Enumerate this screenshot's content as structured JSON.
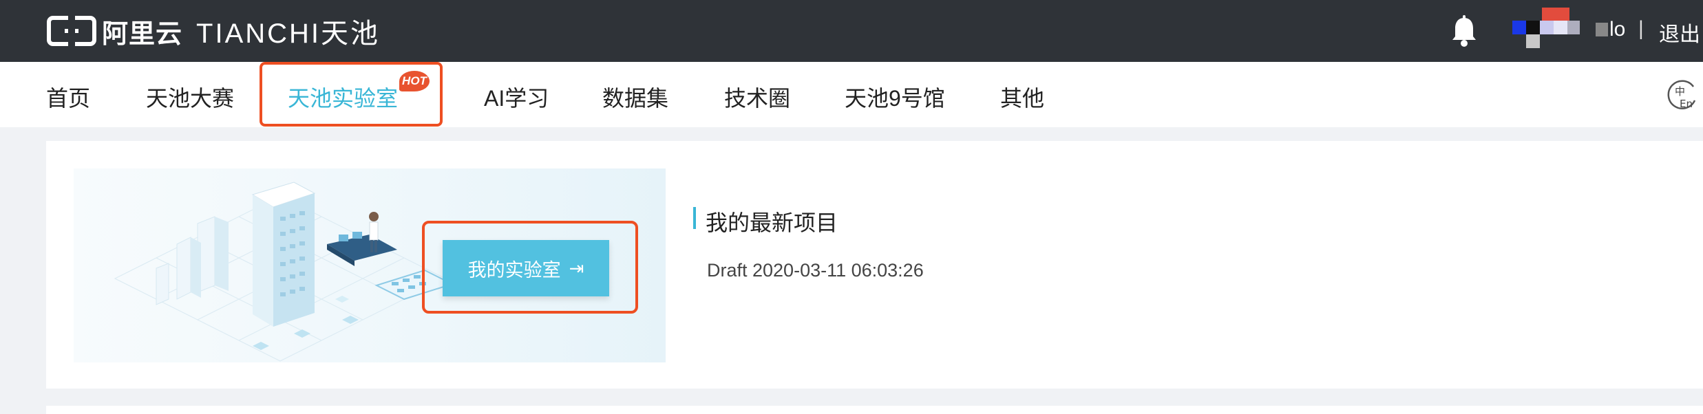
{
  "header": {
    "brand_cn": "阿里云",
    "brand_en": "TIANCHI天池",
    "user": {
      "name": "lo",
      "separator": "|",
      "logout": "退出"
    }
  },
  "nav": {
    "items": [
      {
        "label": "首页"
      },
      {
        "label": "天池大赛"
      },
      {
        "label": "天池实验室",
        "active": true,
        "badge": "HOT"
      },
      {
        "label": "AI学习"
      },
      {
        "label": "数据集"
      },
      {
        "label": "技术圈"
      },
      {
        "label": "天池9号馆"
      },
      {
        "label": "其他"
      }
    ],
    "lang_icon": "cn-en-icon"
  },
  "main": {
    "lab_button": "我的实验室",
    "latest_projects_title": "我的最新项目",
    "draft_text": "Draft 2020-03-11 06:03:26"
  },
  "colors": {
    "topbar": "#2f3338",
    "accent": "#39b6d6",
    "button": "#52c1e0",
    "highlight": "#ee4f22",
    "hot": "#e8532f"
  }
}
